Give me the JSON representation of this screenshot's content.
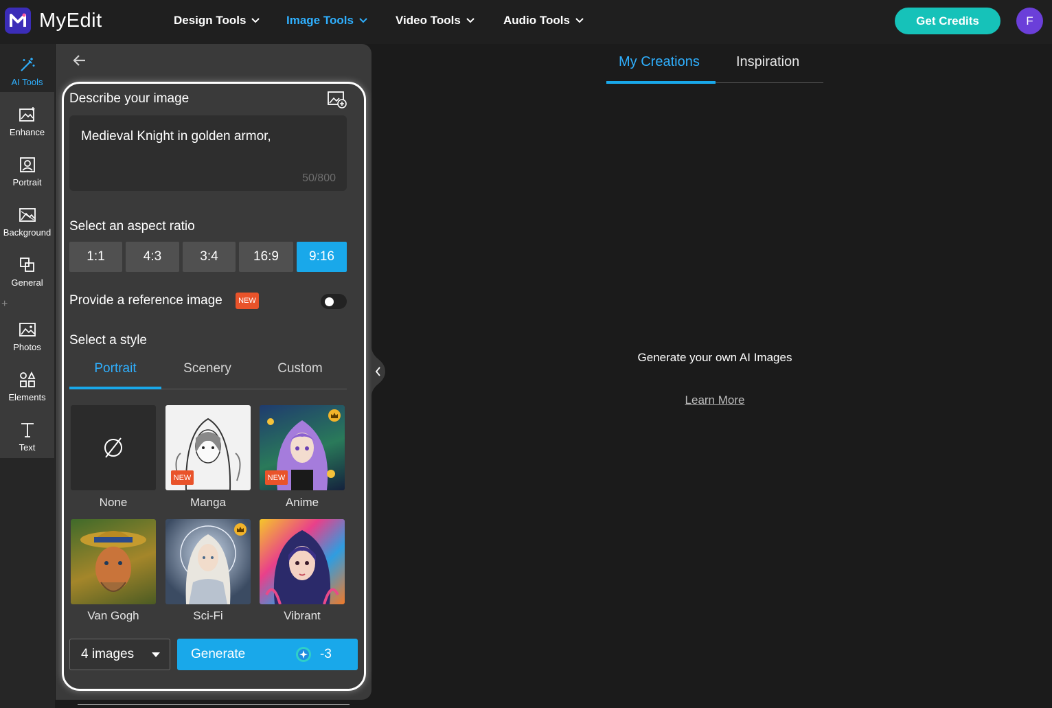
{
  "app": {
    "brand": "MyEdit",
    "avatar_initial": "F",
    "colors": {
      "accent": "#19a8ea",
      "credits": "#16c2b9",
      "badge": "#e9532a",
      "avatar": "#6b3fd9"
    }
  },
  "topnav": {
    "items": [
      {
        "label": "Design Tools"
      },
      {
        "label": "Image Tools"
      },
      {
        "label": "Video Tools"
      },
      {
        "label": "Audio Tools"
      }
    ],
    "active": "Image Tools",
    "credits_label": "Get Credits"
  },
  "rail": {
    "items": [
      {
        "label": "AI Tools",
        "icon": "magic-wand-icon"
      },
      {
        "label": "Enhance",
        "icon": "enhance-icon"
      },
      {
        "label": "Portrait",
        "icon": "portrait-icon"
      },
      {
        "label": "Background",
        "icon": "background-icon"
      },
      {
        "label": "General",
        "icon": "general-icon"
      },
      {
        "label": "Photos",
        "icon": "photos-icon"
      },
      {
        "label": "Elements",
        "icon": "elements-icon"
      },
      {
        "label": "Text",
        "icon": "text-icon"
      }
    ],
    "plus": "+"
  },
  "panel": {
    "describe_label": "Describe your image",
    "prompt_value": "Medieval Knight in golden armor,",
    "prompt_count": "50/800",
    "aspect_label": "Select an aspect ratio",
    "ratios": [
      "1:1",
      "4:3",
      "3:4",
      "16:9",
      "9:16"
    ],
    "active_ratio": "9:16",
    "reference_label": "Provide a reference image",
    "new_badge": "NEW",
    "reference_enabled": false,
    "style_label": "Select a style",
    "style_tabs": [
      "Portrait",
      "Scenery",
      "Custom"
    ],
    "active_style_tab": "Portrait",
    "styles": [
      {
        "name": "None",
        "badge": "",
        "premium": false
      },
      {
        "name": "Manga",
        "badge": "NEW",
        "premium": false
      },
      {
        "name": "Anime",
        "badge": "NEW",
        "premium": true
      },
      {
        "name": "Van Gogh",
        "badge": "",
        "premium": false
      },
      {
        "name": "Sci-Fi",
        "badge": "",
        "premium": true
      },
      {
        "name": "Vibrant",
        "badge": "",
        "premium": false
      }
    ],
    "image_count": "4 images",
    "generate_label": "Generate",
    "generate_cost": "-3"
  },
  "main": {
    "tabs": [
      "My Creations",
      "Inspiration"
    ],
    "active_tab": "My Creations",
    "empty_message": "Generate your own AI Images",
    "learn_more": "Learn More"
  }
}
